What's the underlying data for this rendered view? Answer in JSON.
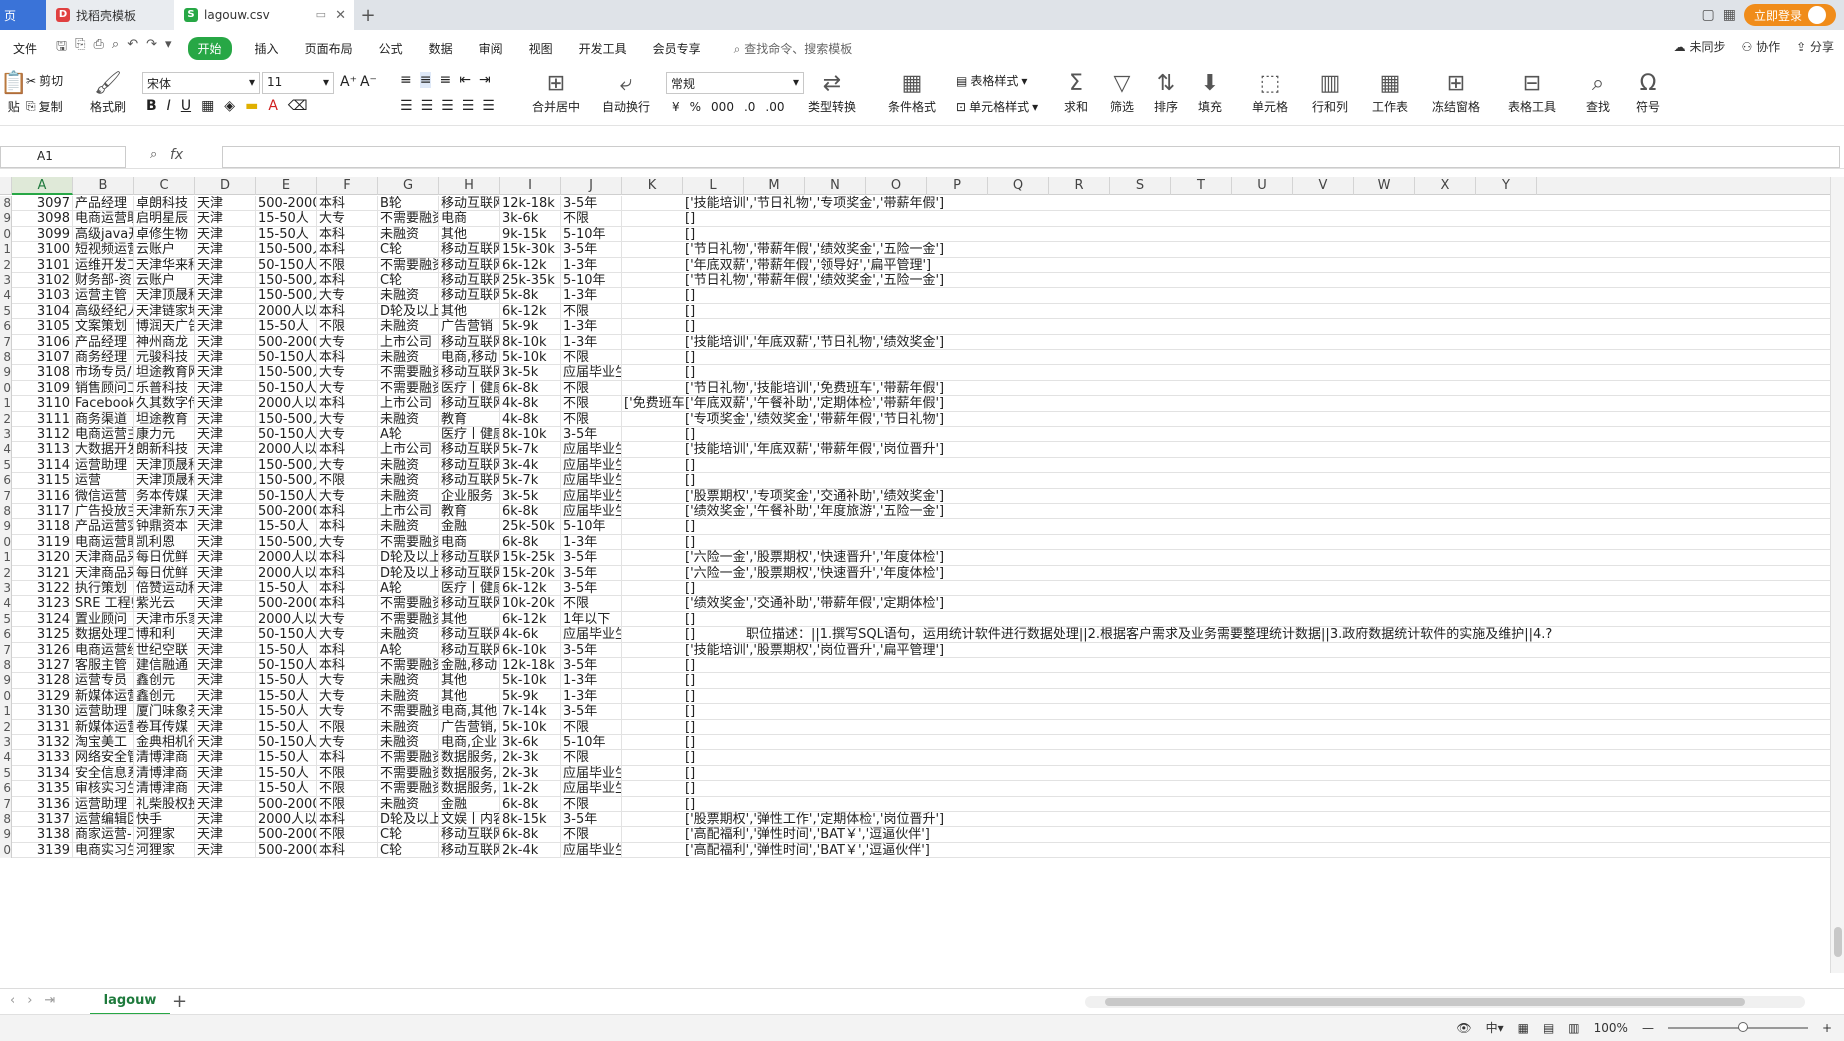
{
  "titlebar": {
    "home_tab": "页",
    "doc_tab": "找稻壳模板",
    "active_tab": "lagouw.csv",
    "new_tab": "+",
    "login_label": "立即登录"
  },
  "menu": {
    "file": "文件",
    "start": "开始",
    "insert": "插入",
    "page_layout": "页面布局",
    "formula": "公式",
    "data": "数据",
    "review": "审阅",
    "view": "视图",
    "dev_tools": "开发工具",
    "member": "会员专享",
    "search": "查找命令、搜索模板",
    "unsync": "未同步",
    "collab": "协作",
    "share": "分享"
  },
  "ribbon": {
    "paste": "贴",
    "cut": "剪切",
    "copy": "复制",
    "format_painter": "格式刷",
    "font_name": "宋体",
    "font_size": "11",
    "merge_center": "合并居中",
    "auto_wrap": "自动换行",
    "number_format": "常规",
    "type_convert": "类型转换",
    "conditional_format": "条件格式",
    "table_style": "表格样式",
    "cell_style": "单元格样式",
    "sum": "求和",
    "filter": "筛选",
    "sort": "排序",
    "fill": "填充",
    "cell": "单元格",
    "row_col": "行和列",
    "worksheet": "工作表",
    "freeze": "冻结窗格",
    "table_tools": "表格工具",
    "find": "查找",
    "symbol": "符号"
  },
  "formula_bar": {
    "name_box": "A1",
    "fx": "fx"
  },
  "columns": [
    "A",
    "B",
    "C",
    "D",
    "E",
    "F",
    "G",
    "H",
    "I",
    "J",
    "K",
    "L",
    "M",
    "N",
    "O",
    "P",
    "Q",
    "R",
    "S",
    "T",
    "U",
    "V",
    "W",
    "X",
    "Y"
  ],
  "rows": [
    {
      "rh": "8",
      "a": "3097",
      "b": "产品经理（",
      "c": "卓朗科技",
      "d": "天津",
      "e": "500-2000人",
      "f": "本科",
      "g": "B轮",
      "h": "移动互联网",
      "i": "12k-18k",
      "j": "3-5年",
      "k": "",
      "l": "['技能培训','节日礼物','专项奖金','带薪年假']"
    },
    {
      "rh": "9",
      "a": "3098",
      "b": "电商运营助",
      "c": "启明星辰",
      "d": "天津",
      "e": "15-50人",
      "f": "大专",
      "g": "不需要融资",
      "h": "电商",
      "i": "3k-6k",
      "j": "不限",
      "k": "",
      "l": "[]"
    },
    {
      "rh": "0",
      "a": "3099",
      "b": "高级java开",
      "c": "卓修生物",
      "d": "天津",
      "e": "15-50人",
      "f": "本科",
      "g": "未融资",
      "h": "其他",
      "i": "9k-15k",
      "j": "5-10年",
      "k": "",
      "l": "[]"
    },
    {
      "rh": "1",
      "a": "3100",
      "b": "短视频运营",
      "c": "云账户",
      "d": "天津",
      "e": "150-500人",
      "f": "本科",
      "g": "C轮",
      "h": "移动互联网",
      "i": "15k-30k",
      "j": "3-5年",
      "k": "",
      "l": "['节日礼物','带薪年假','绩效奖金','五险一金']"
    },
    {
      "rh": "2",
      "a": "3101",
      "b": "运维开发工",
      "c": "天津华来科",
      "d": "天津",
      "e": "50-150人",
      "f": "不限",
      "g": "不需要融资",
      "h": "移动互联网",
      "i": "6k-12k",
      "j": "1-3年",
      "k": "",
      "l": "['年底双薪','带薪年假','领导好','扁平管理']"
    },
    {
      "rh": "3",
      "a": "3102",
      "b": "财务部-资",
      "c": "云账户",
      "d": "天津",
      "e": "150-500人",
      "f": "本科",
      "g": "C轮",
      "h": "移动互联网",
      "i": "25k-35k",
      "j": "5-10年",
      "k": "",
      "l": "['节日礼物','带薪年假','绩效奖金','五险一金']"
    },
    {
      "rh": "4",
      "a": "3103",
      "b": "运营主管",
      "c": "天津顶晟科",
      "d": "天津",
      "e": "150-500人",
      "f": "大专",
      "g": "未融资",
      "h": "移动互联网",
      "i": "5k-8k",
      "j": "1-3年",
      "k": "",
      "l": "[]"
    },
    {
      "rh": "5",
      "a": "3104",
      "b": "高级经纪人",
      "c": "天津链家地",
      "d": "天津",
      "e": "2000人以上",
      "f": "本科",
      "g": "D轮及以上",
      "h": "其他",
      "i": "6k-12k",
      "j": "不限",
      "k": "",
      "l": "[]"
    },
    {
      "rh": "6",
      "a": "3105",
      "b": "文案策划",
      "c": "博润天广告",
      "d": "天津",
      "e": "15-50人",
      "f": "不限",
      "g": "未融资",
      "h": "广告营销",
      "i": "5k-9k",
      "j": "1-3年",
      "k": "",
      "l": "[]"
    },
    {
      "rh": "7",
      "a": "3106",
      "b": "产品经理",
      "c": "神州商龙",
      "d": "天津",
      "e": "500-2000人",
      "f": "大专",
      "g": "上市公司",
      "h": "移动互联网",
      "i": "8k-10k",
      "j": "1-3年",
      "k": "",
      "l": "['技能培训','年底双薪','节日礼物','绩效奖金']"
    },
    {
      "rh": "8",
      "a": "3107",
      "b": "商务经理",
      "c": "元骏科技",
      "d": "天津",
      "e": "50-150人",
      "f": "本科",
      "g": "未融资",
      "h": "电商,移动",
      "i": "5k-10k",
      "j": "不限",
      "k": "",
      "l": "[]"
    },
    {
      "rh": "9",
      "a": "3108",
      "b": "市场专员/",
      "c": "坦途教育网",
      "d": "天津",
      "e": "150-500人",
      "f": "大专",
      "g": "不需要融资",
      "h": "移动互联网",
      "i": "3k-5k",
      "j": "应届毕业生",
      "k": "",
      "l": "[]"
    },
    {
      "rh": "0",
      "a": "3109",
      "b": "销售顾问工",
      "c": "乐普科技",
      "d": "天津",
      "e": "50-150人",
      "f": "大专",
      "g": "不需要融资",
      "h": "医疗丨健康",
      "i": "6k-8k",
      "j": "不限",
      "k": "",
      "l": "['节日礼物','技能培训','免费班车','带薪年假']"
    },
    {
      "rh": "1",
      "a": "3110",
      "b": "Facebook广",
      "c": "久其数字传",
      "d": "天津",
      "e": "2000人以上",
      "f": "本科",
      "g": "上市公司",
      "h": "移动互联网",
      "i": "4k-8k",
      "j": "不限",
      "k": "['免费班车",
      "l": "['年底双薪','午餐补助','定期体检','带薪年假']"
    },
    {
      "rh": "2",
      "a": "3111",
      "b": "商务渠道",
      "c": "坦途教育",
      "d": "天津",
      "e": "150-500人",
      "f": "大专",
      "g": "未融资",
      "h": "教育",
      "i": "4k-8k",
      "j": "不限",
      "k": "",
      "l": "['专项奖金','绩效奖金','带薪年假','节日礼物']"
    },
    {
      "rh": "3",
      "a": "3112",
      "b": "电商运营主",
      "c": "康力元",
      "d": "天津",
      "e": "50-150人",
      "f": "大专",
      "g": "A轮",
      "h": "医疗丨健康",
      "i": "8k-10k",
      "j": "3-5年",
      "k": "",
      "l": "[]"
    },
    {
      "rh": "4",
      "a": "3113",
      "b": "大数据开发",
      "c": "朗新科技",
      "d": "天津",
      "e": "2000人以上",
      "f": "本科",
      "g": "上市公司",
      "h": "移动互联网",
      "i": "5k-7k",
      "j": "应届毕业生",
      "k": "",
      "l": "['技能培训','年底双薪','带薪年假','岗位晋升']"
    },
    {
      "rh": "5",
      "a": "3114",
      "b": "运营助理",
      "c": "天津顶晟科",
      "d": "天津",
      "e": "150-500人",
      "f": "大专",
      "g": "未融资",
      "h": "移动互联网",
      "i": "3k-4k",
      "j": "应届毕业生",
      "k": "",
      "l": "[]"
    },
    {
      "rh": "6",
      "a": "3115",
      "b": "运营",
      "c": "天津顶晟科",
      "d": "天津",
      "e": "150-500人",
      "f": "不限",
      "g": "未融资",
      "h": "移动互联网",
      "i": "5k-7k",
      "j": "应届毕业生",
      "k": "",
      "l": "[]"
    },
    {
      "rh": "7",
      "a": "3116",
      "b": "微信运营",
      "c": "务本传媒",
      "d": "天津",
      "e": "50-150人",
      "f": "大专",
      "g": "未融资",
      "h": "企业服务",
      "i": "3k-5k",
      "j": "应届毕业生",
      "k": "",
      "l": "['股票期权','专项奖金','交通补助','绩效奖金']"
    },
    {
      "rh": "8",
      "a": "3117",
      "b": "广告投放主",
      "c": "天津新东方",
      "d": "天津",
      "e": "500-2000人",
      "f": "本科",
      "g": "上市公司",
      "h": "教育",
      "i": "6k-8k",
      "j": "应届毕业生",
      "k": "",
      "l": "['绩效奖金','午餐补助','年度旅游','五险一金']"
    },
    {
      "rh": "9",
      "a": "3118",
      "b": "产品运营实",
      "c": "钟鼎资本",
      "d": "天津",
      "e": "15-50人",
      "f": "本科",
      "g": "未融资",
      "h": "金融",
      "i": "25k-50k",
      "j": "5-10年",
      "k": "",
      "l": "[]"
    },
    {
      "rh": "0",
      "a": "3119",
      "b": "电商运营助",
      "c": "凯利恩",
      "d": "天津",
      "e": "150-500人",
      "f": "大专",
      "g": "不需要融资",
      "h": "电商",
      "i": "6k-8k",
      "j": "1-3年",
      "k": "",
      "l": "[]"
    },
    {
      "rh": "1",
      "a": "3120",
      "b": "天津商品采",
      "c": "每日优鲜",
      "d": "天津",
      "e": "2000人以上",
      "f": "本科",
      "g": "D轮及以上",
      "h": "移动互联网",
      "i": "15k-25k",
      "j": "3-5年",
      "k": "",
      "l": "['六险一金','股票期权','快速晋升','年度体检']"
    },
    {
      "rh": "2",
      "a": "3121",
      "b": "天津商品采",
      "c": "每日优鲜",
      "d": "天津",
      "e": "2000人以上",
      "f": "本科",
      "g": "D轮及以上",
      "h": "移动互联网",
      "i": "15k-20k",
      "j": "3-5年",
      "k": "",
      "l": "['六险一金','股票期权','快速晋升','年度体检']"
    },
    {
      "rh": "3",
      "a": "3122",
      "b": "执行策划",
      "c": "倍赞运动科",
      "d": "天津",
      "e": "15-50人",
      "f": "本科",
      "g": "A轮",
      "h": "医疗丨健康",
      "i": "6k-12k",
      "j": "3-5年",
      "k": "",
      "l": "[]"
    },
    {
      "rh": "4",
      "a": "3123",
      "b": "SRE 工程师",
      "c": "紫光云",
      "d": "天津",
      "e": "500-2000人",
      "f": "本科",
      "g": "不需要融资",
      "h": "移动互联网",
      "i": "10k-20k",
      "j": "不限",
      "k": "",
      "l": "['绩效奖金','交通补助','带薪年假','定期体检']"
    },
    {
      "rh": "5",
      "a": "3124",
      "b": "置业顾问",
      "c": "天津市乐家",
      "d": "天津",
      "e": "2000人以上",
      "f": "大专",
      "g": "不需要融资",
      "h": "其他",
      "i": "6k-12k",
      "j": "1年以下",
      "k": "",
      "l": "[]"
    },
    {
      "rh": "6",
      "a": "3125",
      "b": "数据处理工",
      "c": "博和利",
      "d": "天津",
      "e": "50-150人",
      "f": "大专",
      "g": "未融资",
      "h": "移动互联网",
      "i": "4k-6k",
      "j": "应届毕业生",
      "k": "",
      "l": "[]",
      "m": "职位描述：||1.撰写SQL语句，运用统计软件进行数据处理||2.根据客户需求及业务需要整理统计数据||3.政府数据统计软件的实施及维护||4.?"
    },
    {
      "rh": "7",
      "a": "3126",
      "b": "电商运营经",
      "c": "世纪空联",
      "d": "天津",
      "e": "15-50人",
      "f": "本科",
      "g": "A轮",
      "h": "移动互联网",
      "i": "6k-10k",
      "j": "3-5年",
      "k": "",
      "l": "['技能培训','股票期权','岗位晋升','扁平管理']"
    },
    {
      "rh": "8",
      "a": "3127",
      "b": "客服主管",
      "c": "建信融通",
      "d": "天津",
      "e": "50-150人",
      "f": "本科",
      "g": "不需要融资",
      "h": "金融,移动",
      "i": "12k-18k",
      "j": "3-5年",
      "k": "",
      "l": "[]"
    },
    {
      "rh": "9",
      "a": "3128",
      "b": "运营专员",
      "c": "鑫创元",
      "d": "天津",
      "e": "15-50人",
      "f": "大专",
      "g": "未融资",
      "h": "其他",
      "i": "5k-10k",
      "j": "1-3年",
      "k": "",
      "l": "[]"
    },
    {
      "rh": "0",
      "a": "3129",
      "b": "新媒体运营",
      "c": "鑫创元",
      "d": "天津",
      "e": "15-50人",
      "f": "大专",
      "g": "未融资",
      "h": "其他",
      "i": "5k-9k",
      "j": "1-3年",
      "k": "",
      "l": "[]"
    },
    {
      "rh": "1",
      "a": "3130",
      "b": "运营助理",
      "c": "厦门味象茶",
      "d": "天津",
      "e": "15-50人",
      "f": "大专",
      "g": "不需要融资",
      "h": "电商,其他",
      "i": "7k-14k",
      "j": "3-5年",
      "k": "",
      "l": "[]"
    },
    {
      "rh": "2",
      "a": "3131",
      "b": "新媒体运营",
      "c": "卷耳传媒",
      "d": "天津",
      "e": "15-50人",
      "f": "不限",
      "g": "未融资",
      "h": "广告营销,",
      "i": "5k-10k",
      "j": "不限",
      "k": "",
      "l": "[]"
    },
    {
      "rh": "3",
      "a": "3132",
      "b": "淘宝美工",
      "c": "金典相机行",
      "d": "天津",
      "e": "50-150人",
      "f": "大专",
      "g": "未融资",
      "h": "电商,企业",
      "i": "3k-6k",
      "j": "5-10年",
      "k": "",
      "l": "[]"
    },
    {
      "rh": "4",
      "a": "3133",
      "b": "网络安全管",
      "c": "清博津商",
      "d": "天津",
      "e": "15-50人",
      "f": "本科",
      "g": "不需要融资",
      "h": "数据服务,",
      "i": "2k-3k",
      "j": "不限",
      "k": "",
      "l": "[]"
    },
    {
      "rh": "5",
      "a": "3134",
      "b": "安全信息系",
      "c": "清博津商",
      "d": "天津",
      "e": "15-50人",
      "f": "不限",
      "g": "不需要融资",
      "h": "数据服务,",
      "i": "2k-3k",
      "j": "应届毕业生",
      "k": "",
      "l": "[]"
    },
    {
      "rh": "6",
      "a": "3135",
      "b": "审核实习生",
      "c": "清博津商",
      "d": "天津",
      "e": "15-50人",
      "f": "不限",
      "g": "不需要融资",
      "h": "数据服务,",
      "i": "1k-2k",
      "j": "应届毕业生",
      "k": "",
      "l": "[]"
    },
    {
      "rh": "7",
      "a": "3136",
      "b": "运营助理",
      "c": "礼柴股权投",
      "d": "天津",
      "e": "500-2000人",
      "f": "不限",
      "g": "未融资",
      "h": "金融",
      "i": "6k-8k",
      "j": "不限",
      "k": "",
      "l": "[]"
    },
    {
      "rh": "8",
      "a": "3137",
      "b": "运营编辑区",
      "c": "快手",
      "d": "天津",
      "e": "2000人以上",
      "f": "本科",
      "g": "D轮及以上",
      "h": "文娱丨内容",
      "i": "8k-15k",
      "j": "3-5年",
      "k": "",
      "l": "['股票期权','弹性工作','定期体检','岗位晋升']"
    },
    {
      "rh": "9",
      "a": "3138",
      "b": "商家运营-",
      "c": "河狸家",
      "d": "天津",
      "e": "500-2000人",
      "f": "不限",
      "g": "C轮",
      "h": "移动互联网",
      "i": "6k-8k",
      "j": "不限",
      "k": "",
      "l": "['高配福利','弹性时间','BAT￥','逗逼伙伴']"
    },
    {
      "rh": "0",
      "a": "3139",
      "b": "电商实习生",
      "c": "河狸家",
      "d": "天津",
      "e": "500-2000人",
      "f": "本科",
      "g": "C轮",
      "h": "移动互联网",
      "i": "2k-4k",
      "j": "应届毕业生",
      "k": "",
      "l": "['高配福利','弹性时间','BAT￥','逗逼伙伴']"
    }
  ],
  "sheet": {
    "name": "lagouw",
    "add": "+"
  },
  "status": {
    "zoom": "100%"
  }
}
